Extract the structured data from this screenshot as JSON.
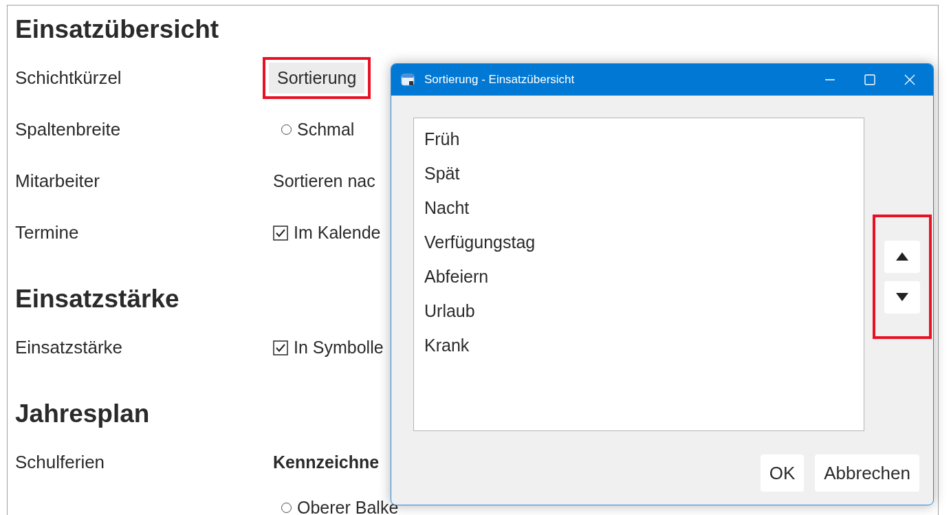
{
  "sections": [
    {
      "heading": "Einsatzübersicht",
      "rows": [
        {
          "label": "Schichtkürzel",
          "controls": [
            {
              "kind": "button",
              "text": "Sortierung",
              "highlighted": true
            }
          ]
        },
        {
          "label": "Spaltenbreite",
          "controls": [
            {
              "kind": "radio",
              "text": "Schmal",
              "checked": false
            }
          ]
        },
        {
          "label": "Mitarbeiter",
          "controls": [
            {
              "kind": "text",
              "text": "Sortieren nac"
            }
          ]
        },
        {
          "label": "Termine",
          "controls": [
            {
              "kind": "checkbox",
              "text": "Im Kalende",
              "checked": true
            }
          ]
        }
      ]
    },
    {
      "heading": "Einsatzstärke",
      "rows": [
        {
          "label": "Einsatzstärke",
          "controls": [
            {
              "kind": "checkbox",
              "text": "In Symbolle",
              "checked": true
            }
          ]
        }
      ]
    },
    {
      "heading": "Jahresplan",
      "rows": [
        {
          "label": "Schulferien",
          "controls": [
            {
              "kind": "bold",
              "text": "Kennzeichne"
            },
            {
              "kind": "radio",
              "text": "Oberer Balke",
              "checked": false
            }
          ]
        }
      ]
    }
  ],
  "dialog": {
    "title": "Sortierung - Einsatzübersicht",
    "items": [
      {
        "label": "Früh",
        "selected": false
      },
      {
        "label": "Spät",
        "selected": false
      },
      {
        "label": "Nacht",
        "selected": false
      },
      {
        "label": "Verfügungstag",
        "selected": false
      },
      {
        "label": "Abfeiern",
        "selected": false
      },
      {
        "label": "Urlaub",
        "selected": false
      },
      {
        "label": "Krank",
        "selected": false
      }
    ],
    "move_buttons_highlighted": true,
    "buttons": [
      "OK",
      "Abbrechen"
    ]
  }
}
